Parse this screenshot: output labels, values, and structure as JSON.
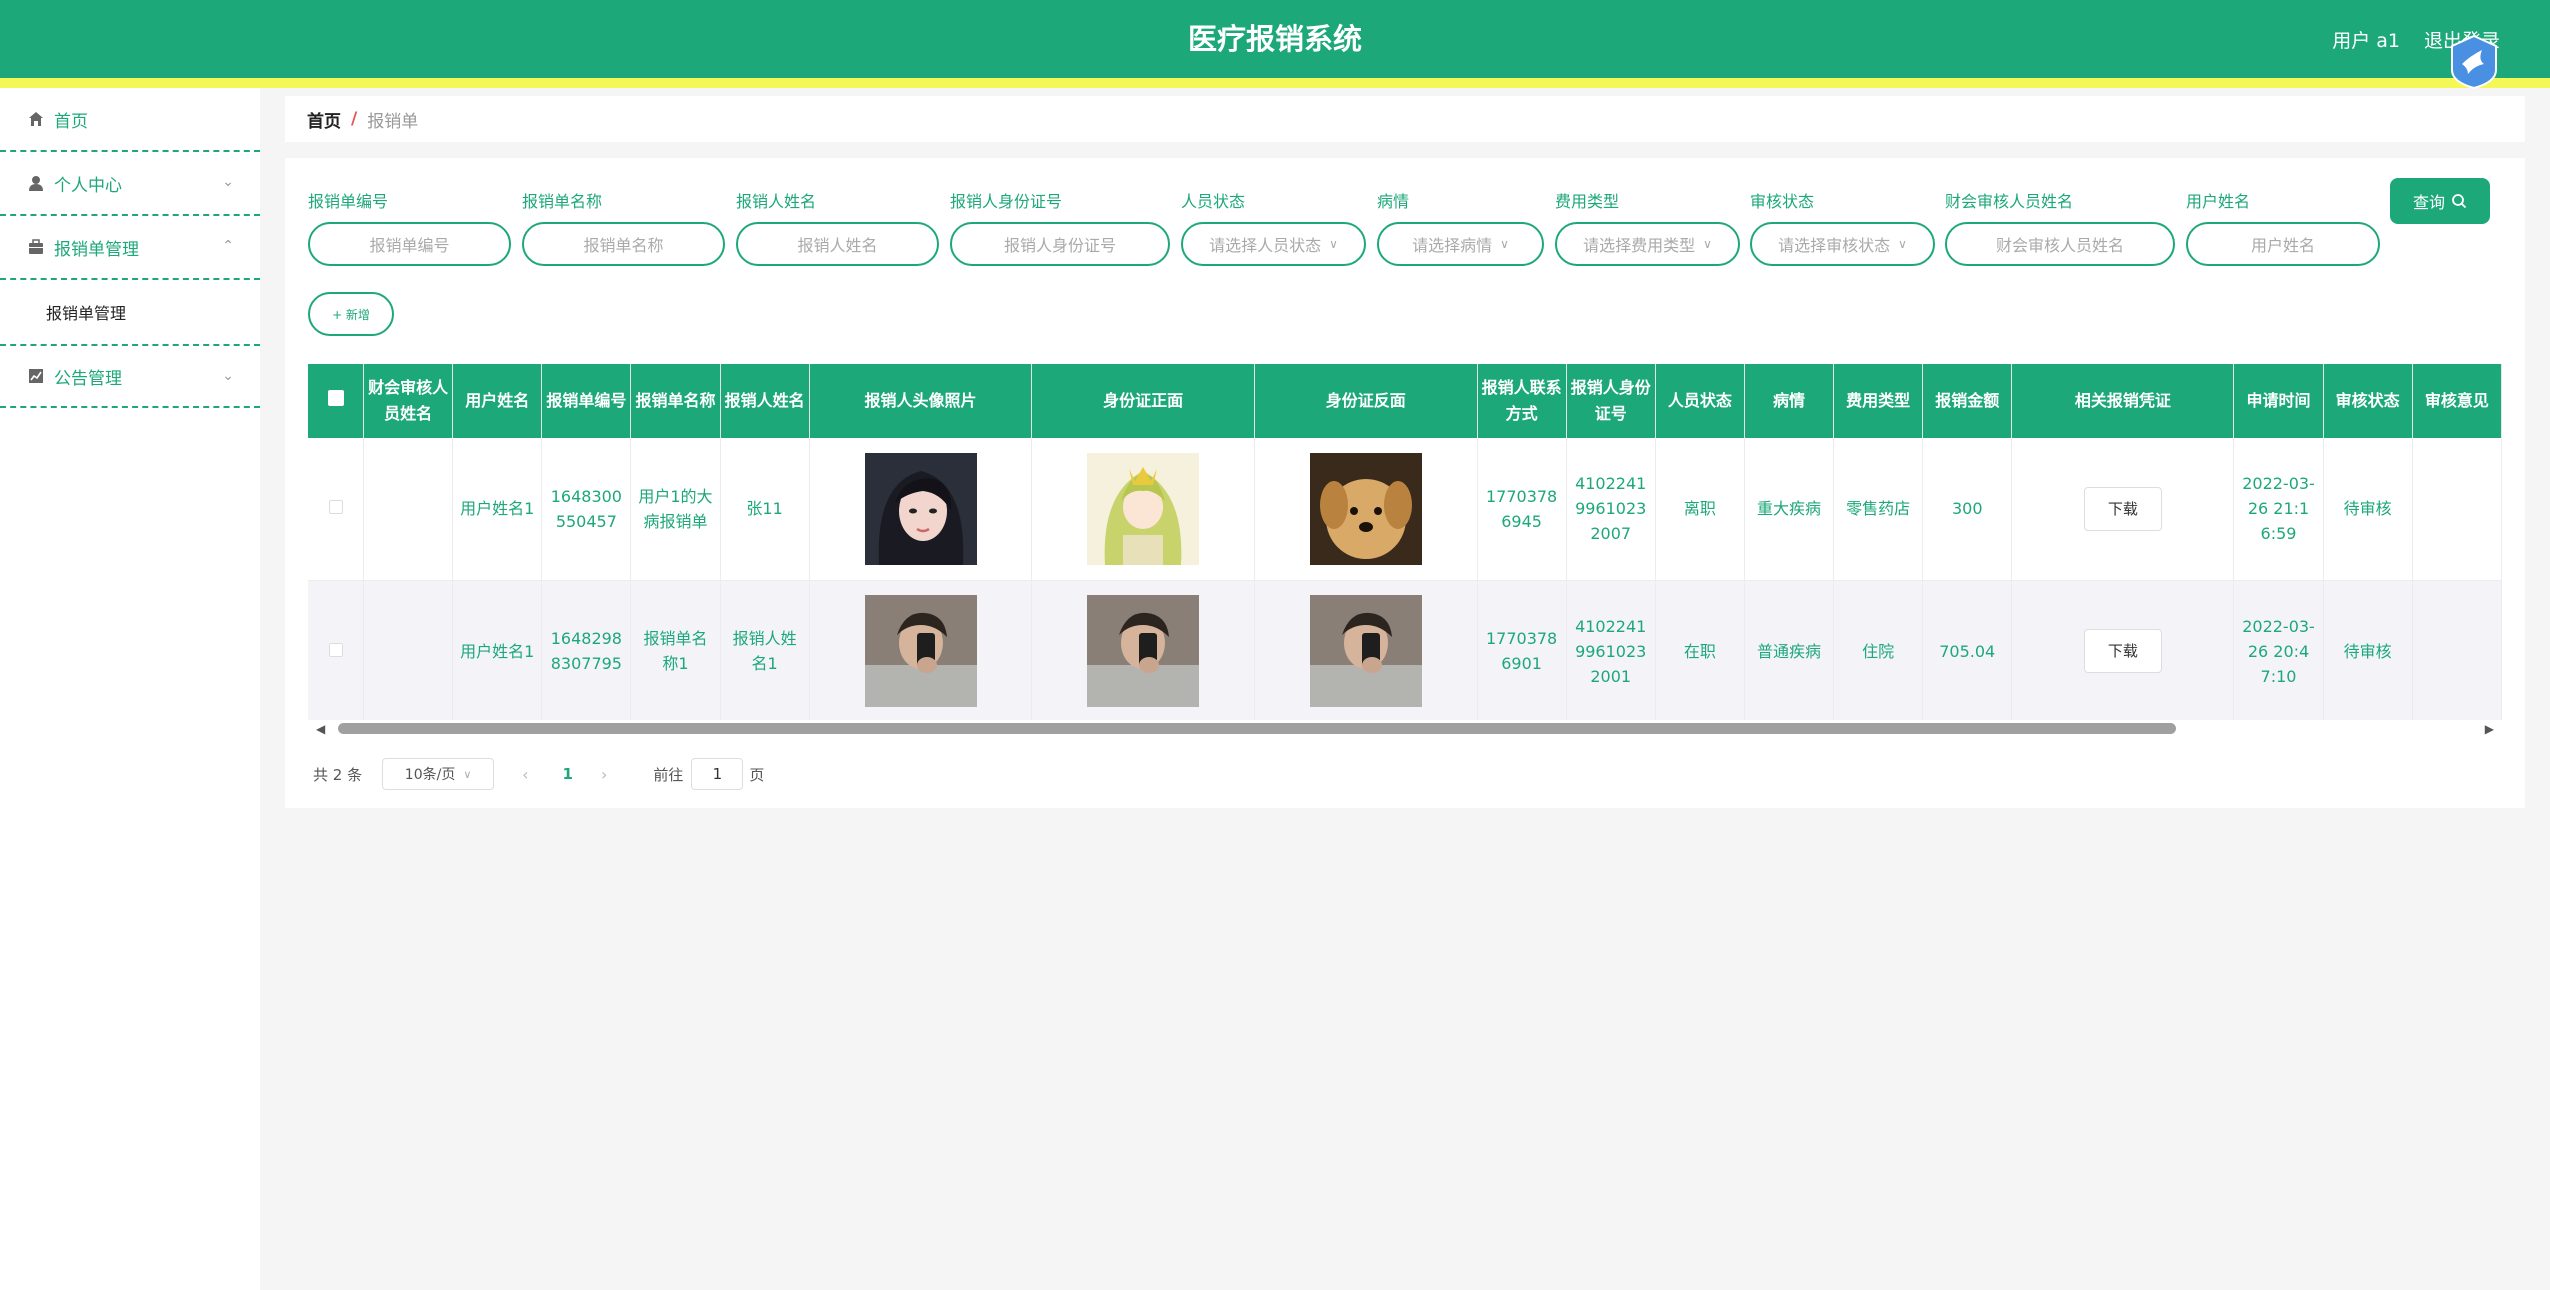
{
  "header": {
    "title": "医疗报销系统",
    "user": "用户 a1",
    "logout": "退出登录"
  },
  "sidebar": {
    "items": [
      {
        "label": "首页",
        "icon": "home-icon"
      },
      {
        "label": "个人中心",
        "icon": "user-icon"
      },
      {
        "label": "报销单管理",
        "icon": "briefcase-icon"
      },
      {
        "label": "公告管理",
        "icon": "chart-icon"
      }
    ],
    "submenu": {
      "label": "报销单管理"
    }
  },
  "breadcrumb": {
    "home": "首页",
    "separator": "/",
    "current": "报销单"
  },
  "filters": [
    {
      "label": "报销单编号",
      "placeholder": "报销单编号"
    },
    {
      "label": "报销单名称",
      "placeholder": "报销单名称"
    },
    {
      "label": "报销人姓名",
      "placeholder": "报销人姓名"
    },
    {
      "label": "报销人身份证号",
      "placeholder": "报销人身份证号"
    },
    {
      "label": "人员状态",
      "placeholder": "请选择人员状态"
    },
    {
      "label": "病情",
      "placeholder": "请选择病情"
    },
    {
      "label": "费用类型",
      "placeholder": "请选择费用类型"
    },
    {
      "label": "审核状态",
      "placeholder": "请选择审核状态"
    },
    {
      "label": "财会审核人员姓名",
      "placeholder": "财会审核人员姓名"
    },
    {
      "label": "用户姓名",
      "placeholder": "用户姓名"
    }
  ],
  "actions": {
    "query": "查询",
    "add": "+ 新增"
  },
  "table": {
    "headers": [
      "财会审核人员姓名",
      "用户姓名",
      "报销单编号",
      "报销单名称",
      "报销人姓名",
      "报销人头像照片",
      "身份证正面",
      "身份证反面",
      "报销人联系方式",
      "报销人身份证号",
      "人员状态",
      "病情",
      "费用类型",
      "报销金额",
      "相关报销凭证",
      "申请时间",
      "审核状态",
      "审核意见"
    ],
    "rows": [
      {
        "auditor": "",
        "user_name": "用户姓名1",
        "form_no": "1648300550457",
        "form_name": "用户1的大病报销单",
        "claimant": "张11",
        "contact": "17703786945",
        "id_no": "410224199610232007",
        "staff_status": "离职",
        "illness": "重大疾病",
        "fee_type": "零售药店",
        "amount": "300",
        "voucher_btn": "下载",
        "apply_time": "2022-03-26 21:16:59",
        "audit_status": "待审核",
        "audit_comment": ""
      },
      {
        "auditor": "",
        "user_name": "用户姓名1",
        "form_no": "16482988307795",
        "form_name": "报销单名称1",
        "claimant": "报销人姓名1",
        "contact": "17703786901",
        "id_no": "410224199610232001",
        "staff_status": "在职",
        "illness": "普通疾病",
        "fee_type": "住院",
        "amount": "705.04",
        "voucher_btn": "下载",
        "apply_time": "2022-03-26 20:47:10",
        "audit_status": "待审核",
        "audit_comment": ""
      }
    ]
  },
  "pagination": {
    "total": "共 2 条",
    "page_size": "10条/页",
    "current_page": "1",
    "goto_label": "前往",
    "goto_value": "1",
    "goto_unit": "页"
  },
  "colors": {
    "primary": "#1da879",
    "stripe": "#f4f857"
  }
}
